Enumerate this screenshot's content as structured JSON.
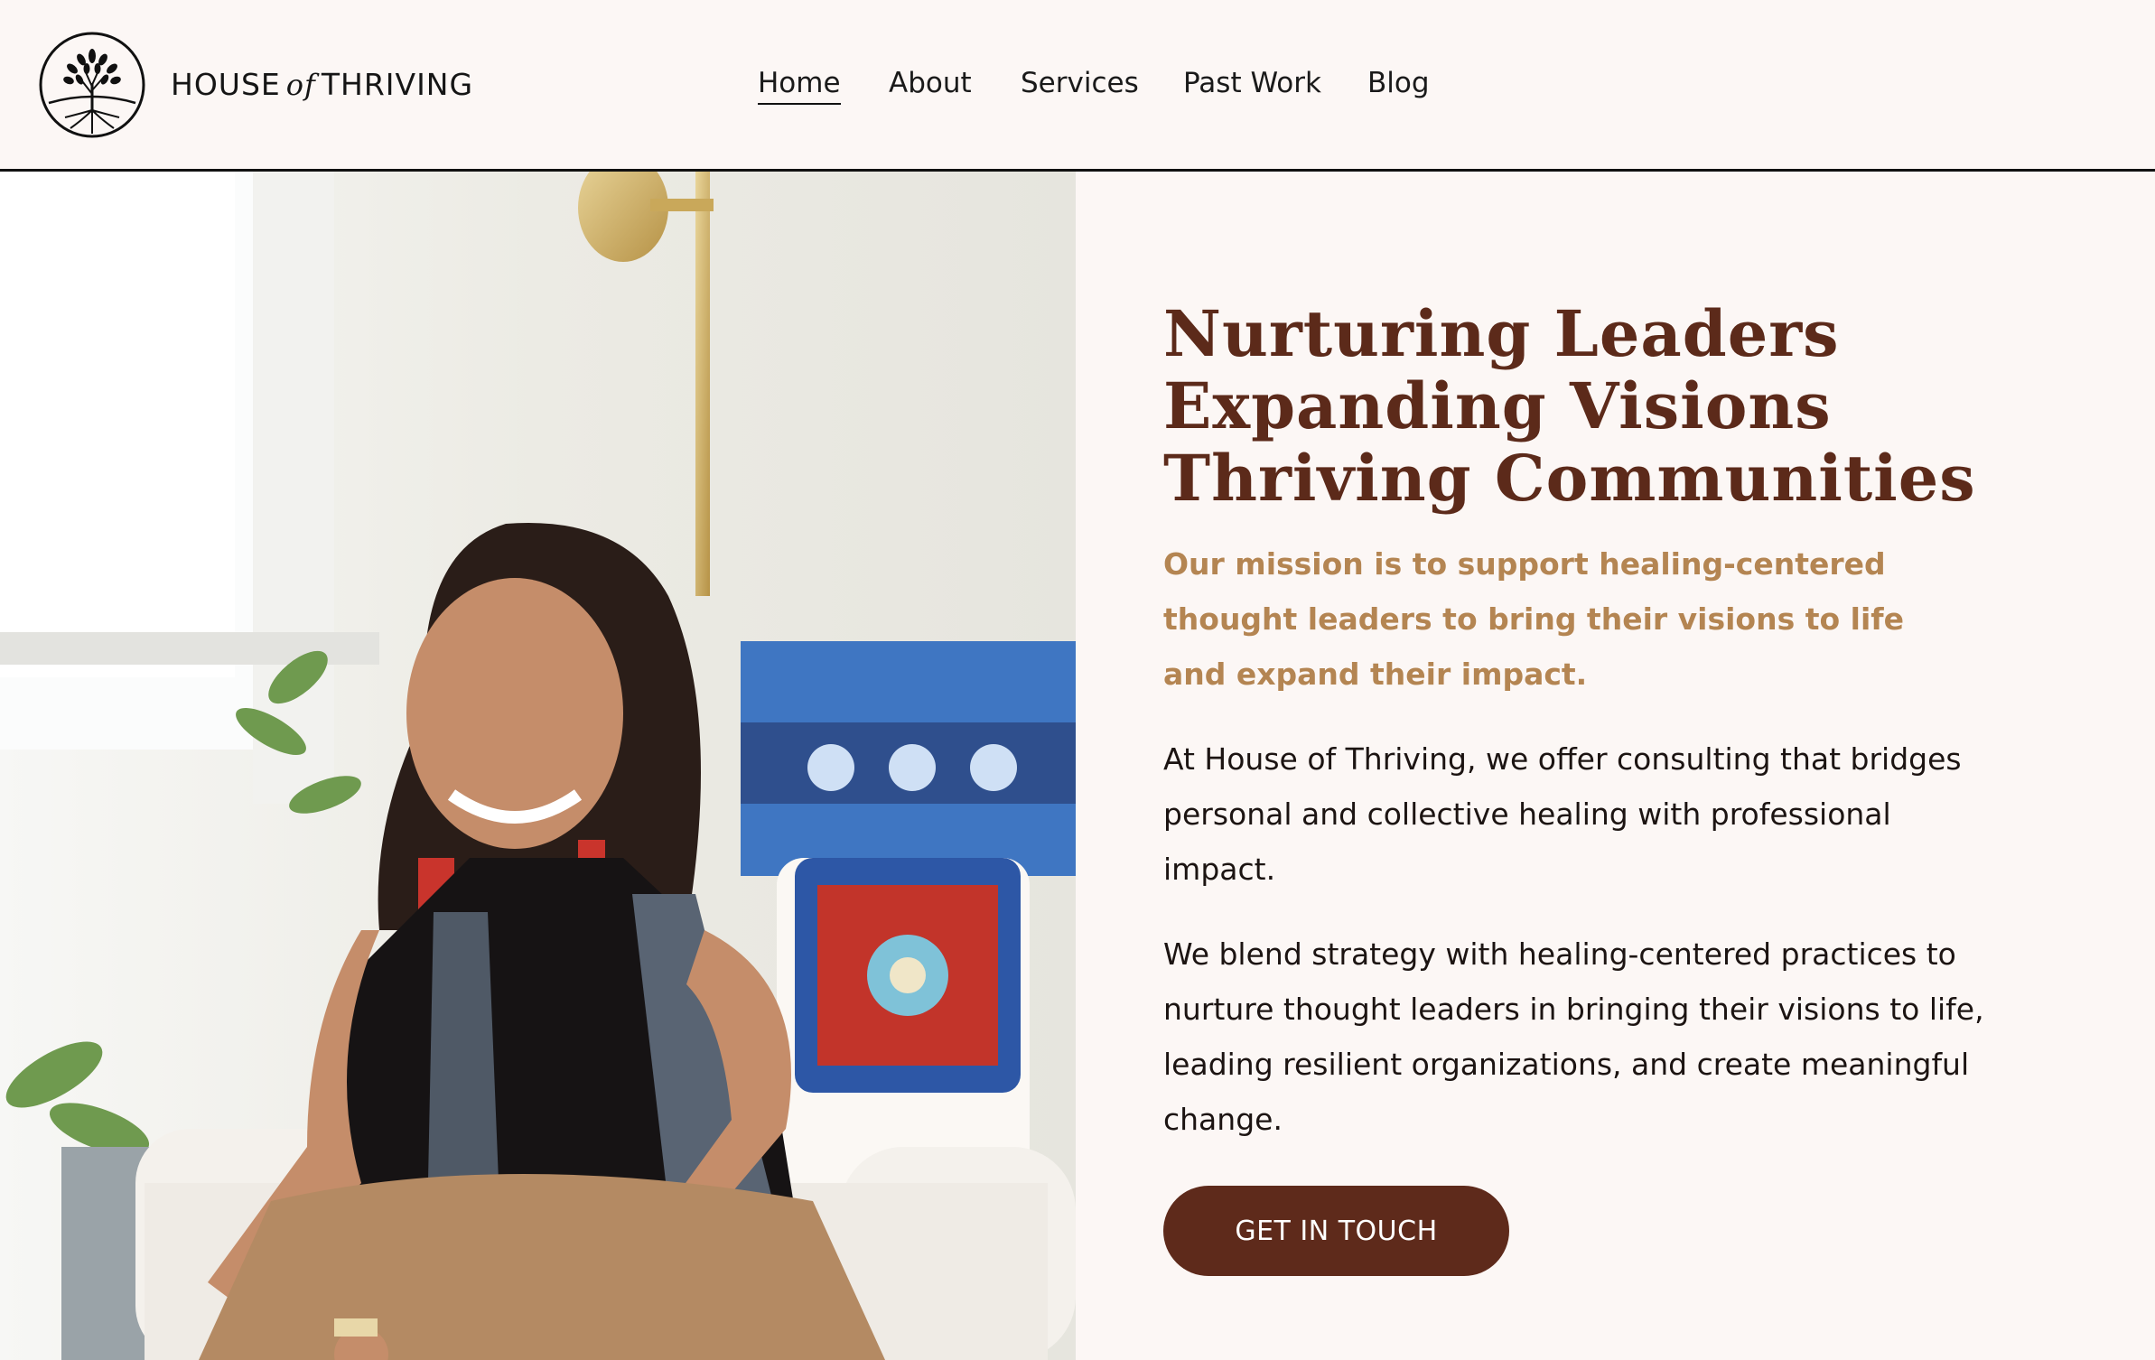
{
  "brand": {
    "name_prefix": "HOUSE",
    "name_connector": "of",
    "name_suffix": "THRIVING",
    "logo_icon": "tree-of-life-icon"
  },
  "nav": {
    "items": [
      {
        "label": "Home",
        "active": true
      },
      {
        "label": "About",
        "active": false
      },
      {
        "label": "Services",
        "active": false
      },
      {
        "label": "Past Work",
        "active": false
      },
      {
        "label": "Blog",
        "active": false
      }
    ]
  },
  "hero": {
    "headline": [
      "Nurturing Leaders",
      "Expanding Visions",
      "Thriving Communities"
    ],
    "mission": "Our mission is to support healing-centered thought leaders to bring their visions to life and expand their impact.",
    "paragraphs": [
      "At House of Thriving, we offer consulting that bridges personal and collective healing with professional impact.",
      "We blend strategy with healing-centered practices to nurture thought leaders in bringing their visions to life, leading resilient organizations, and create meaningful change."
    ],
    "cta_label": "GET IN TOUCH"
  },
  "colors": {
    "background": "#fcf7f5",
    "headline": "#5c2a1a",
    "mission": "#b48552",
    "button": "#5e2a1b"
  }
}
